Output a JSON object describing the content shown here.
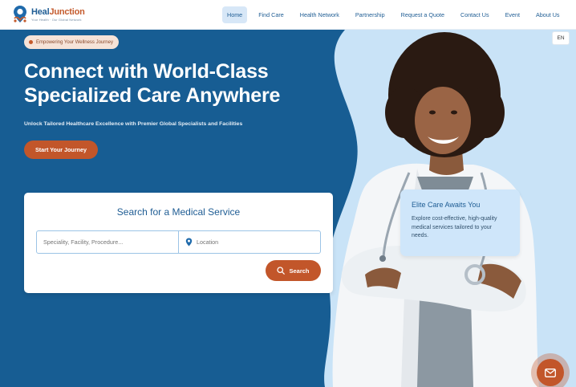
{
  "brand": {
    "name_part1": "Heal",
    "name_part2": "Junction",
    "tagline": "Your Health · Our Global Network"
  },
  "nav": {
    "items": [
      {
        "label": "Home",
        "active": true
      },
      {
        "label": "Find Care",
        "active": false
      },
      {
        "label": "Health Network",
        "active": false
      },
      {
        "label": "Partnership",
        "active": false
      },
      {
        "label": "Request a Quote",
        "active": false
      },
      {
        "label": "Contact Us",
        "active": false
      },
      {
        "label": "Event",
        "active": false
      },
      {
        "label": "About Us",
        "active": false
      }
    ]
  },
  "language": "EN",
  "hero": {
    "badge": "Empowering Your Wellness Journey",
    "title_line1": "Connect with World-Class",
    "title_line2": "Specialized Care Anywhere",
    "subtitle": "Unlock Tailored Healthcare Excellence with Premier Global Specialists and Facilities",
    "cta": "Start Your Journey"
  },
  "search": {
    "title": "Search for a Medical Service",
    "specialty_placeholder": "Speciality, Facility, Procedure...",
    "location_placeholder": "Location",
    "button": "Search"
  },
  "info_card": {
    "title": "Elite Care Awaits You",
    "body": "Explore cost-effective, high-quality medical services tailored to your needs."
  },
  "icons": {
    "location": "map-pin-icon",
    "search": "magnifier-icon",
    "mail": "envelope-icon"
  },
  "colors": {
    "hero_blue": "#175d93",
    "accent_orange": "#c2562a",
    "light_blue": "#cfe6fa",
    "brand_blue": "#1f5d94"
  }
}
